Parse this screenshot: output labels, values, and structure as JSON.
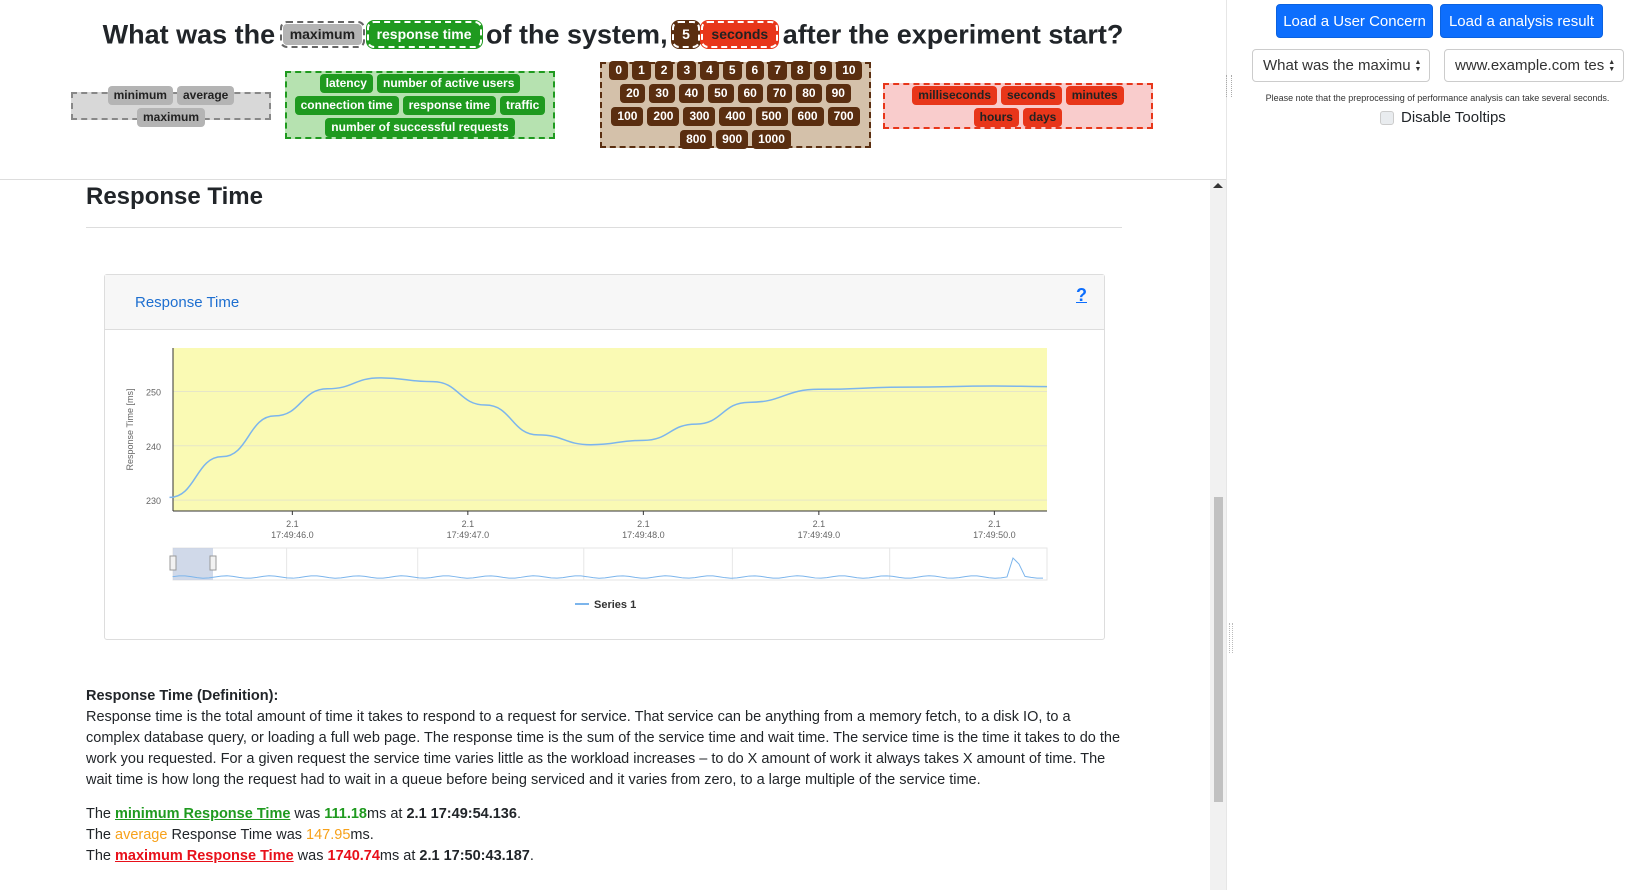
{
  "question": {
    "w1": "What was the",
    "agg": "maximum",
    "metric": "response time",
    "w2": "of the system,",
    "num": "5",
    "unit": "seconds",
    "w3": "after the experiment start?"
  },
  "aggregations": [
    "minimum",
    "average",
    "maximum"
  ],
  "metrics": [
    "latency",
    "number of active users",
    "connection time",
    "response time",
    "traffic",
    "number of successful requests"
  ],
  "numbers": [
    "0",
    "1",
    "2",
    "3",
    "4",
    "5",
    "6",
    "7",
    "8",
    "9",
    "10",
    "20",
    "30",
    "40",
    "50",
    "60",
    "70",
    "80",
    "90",
    "100",
    "200",
    "300",
    "400",
    "500",
    "600",
    "700",
    "800",
    "900",
    "1000"
  ],
  "units": [
    "milliseconds",
    "seconds",
    "minutes",
    "hours",
    "days"
  ],
  "sidebar": {
    "btn_concern": "Load a User Concern",
    "btn_result": "Load a analysis result",
    "select_question": "What was the maximu",
    "select_url": "www.example.com tes",
    "note": "Please note that the preprocessing of performance analysis can take several seconds.",
    "tooltip_label": "Disable Tooltips"
  },
  "main": {
    "title": "Response Time",
    "card_title": "Response Time",
    "help": "?"
  },
  "colors": {
    "accent": "#0d6efd",
    "plot_bg": "#fafab4",
    "series": "#7cb5ec",
    "green": "#1f9a1f",
    "orange": "#f7a11a",
    "red": "#e8101a"
  },
  "chart_data": {
    "type": "line",
    "title": "",
    "ylabel": "Response Time [ms]",
    "xlabel": "",
    "ylim": [
      228,
      258
    ],
    "yticks": [
      230,
      240,
      250
    ],
    "xtick_labels": [
      {
        "date": "2.1",
        "time": "17:49:46.0"
      },
      {
        "date": "2.1",
        "time": "17:49:47.0"
      },
      {
        "date": "2.1",
        "time": "17:49:48.0"
      },
      {
        "date": "2.1",
        "time": "17:49:49.0"
      },
      {
        "date": "2.1",
        "time": "17:49:50.0"
      }
    ],
    "series": [
      {
        "name": "Series 1",
        "x": [
          45.3,
          45.6,
          45.9,
          46.2,
          46.5,
          46.8,
          47.1,
          47.4,
          47.7,
          48.0,
          48.3,
          48.6,
          49.0,
          49.5,
          50.0,
          50.3
        ],
        "values": [
          230.5,
          238,
          245.5,
          250.5,
          252.5,
          251.8,
          247.5,
          242,
          240.2,
          241,
          244,
          248,
          250.4,
          250.8,
          251,
          250.9
        ]
      }
    ],
    "legend": "bottom-center",
    "grid": true
  }
}
